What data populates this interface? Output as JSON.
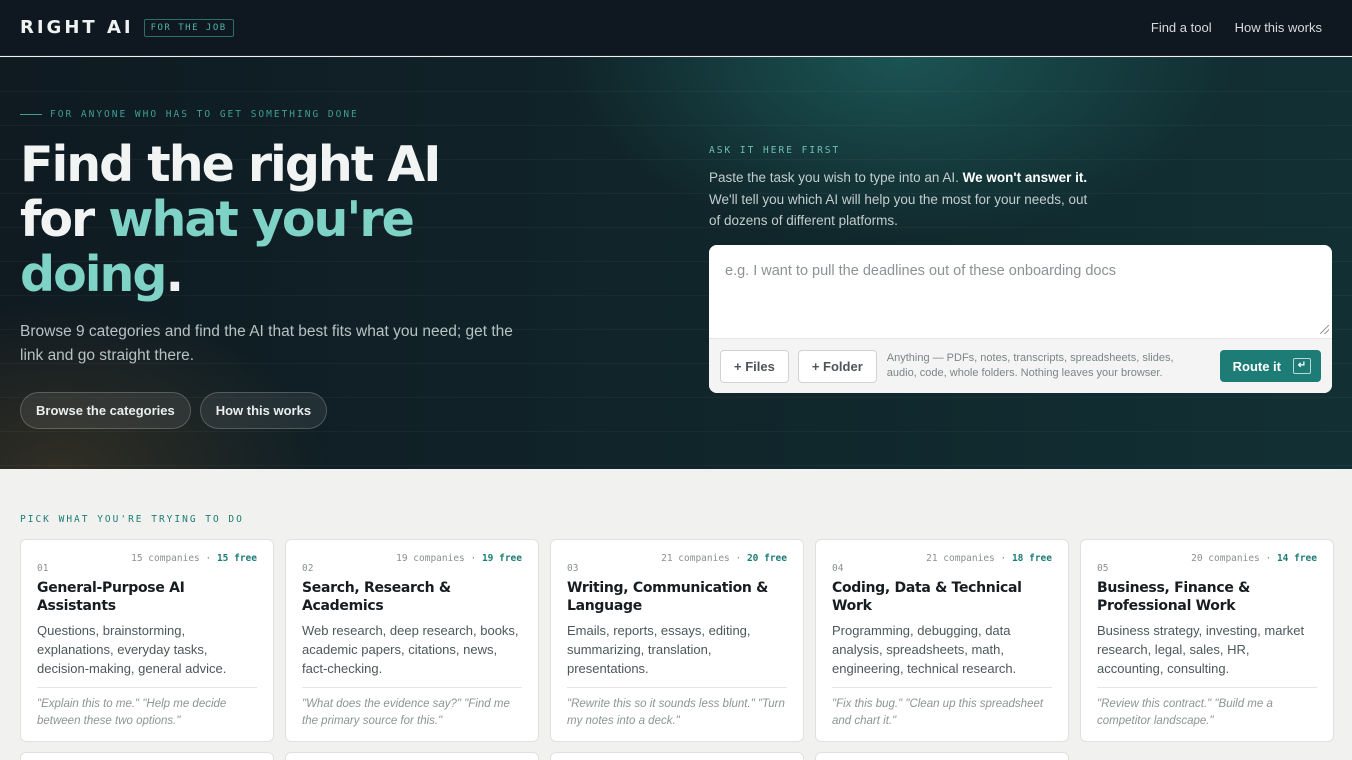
{
  "header": {
    "logo": "RIGHT AI",
    "logo_tag": "FOR THE JOB",
    "nav": [
      {
        "label": "Find a tool"
      },
      {
        "label": "How this works"
      }
    ]
  },
  "hero": {
    "eyebrow": "FOR ANYONE WHO HAS TO GET SOMETHING DONE",
    "headline_part1": "Find the right AI",
    "headline_part2": "for",
    "headline_accent": "what you're doing",
    "headline_end": ".",
    "subtext": "Browse 9 categories and find the AI that best fits what you need; get the link and go straight there.",
    "buttons": [
      {
        "label": "Browse the categories"
      },
      {
        "label": "How this works"
      }
    ]
  },
  "ask": {
    "label": "ASK IT HERE FIRST",
    "desc_part1": "Paste the task you wish to type into an AI.",
    "desc_bold": "We won't answer it.",
    "desc_part2": "We'll tell you which AI will help you the most for your needs, out of dozens of different platforms.",
    "placeholder": "e.g. I want to pull the deadlines out of these onboarding docs",
    "files_label": "+ Files",
    "folder_label": "+ Folder",
    "note": "Anything — PDFs, notes, transcripts, spreadsheets, slides, audio, code, whole folders. Nothing leaves your browser.",
    "route_label": "Route it",
    "enter_glyph": "↵"
  },
  "categories": {
    "label": "PICK WHAT YOU'RE TRYING TO DO",
    "items": [
      {
        "num": "01",
        "companies": "15 companies",
        "free": "15 free",
        "title": "General-Purpose AI Assistants",
        "desc": "Questions, brainstorming, explanations, everyday tasks, decision-making, general advice.",
        "quote": "\"Explain this to me.\" \"Help me decide between these two options.\""
      },
      {
        "num": "02",
        "companies": "19 companies",
        "free": "19 free",
        "title": "Search, Research & Academics",
        "desc": "Web research, deep research, books, academic papers, citations, news, fact-checking.",
        "quote": "\"What does the evidence say?\" \"Find me the primary source for this.\""
      },
      {
        "num": "03",
        "companies": "21 companies",
        "free": "20 free",
        "title": "Writing, Communication & Language",
        "desc": "Emails, reports, essays, editing, summarizing, translation, presentations.",
        "quote": "\"Rewrite this so it sounds less blunt.\" \"Turn my notes into a deck.\""
      },
      {
        "num": "04",
        "companies": "21 companies",
        "free": "18 free",
        "title": "Coding, Data & Technical Work",
        "desc": "Programming, debugging, data analysis, spreadsheets, math, engineering, technical research.",
        "quote": "\"Fix this bug.\" \"Clean up this spreadsheet and chart it.\""
      },
      {
        "num": "05",
        "companies": "20 companies",
        "free": "14 free",
        "title": "Business, Finance & Professional Work",
        "desc": "Business strategy, investing, market research, legal, sales, HR, accounting, consulting.",
        "quote": "\"Review this contract.\" \"Build me a competitor landscape.\""
      }
    ]
  }
}
